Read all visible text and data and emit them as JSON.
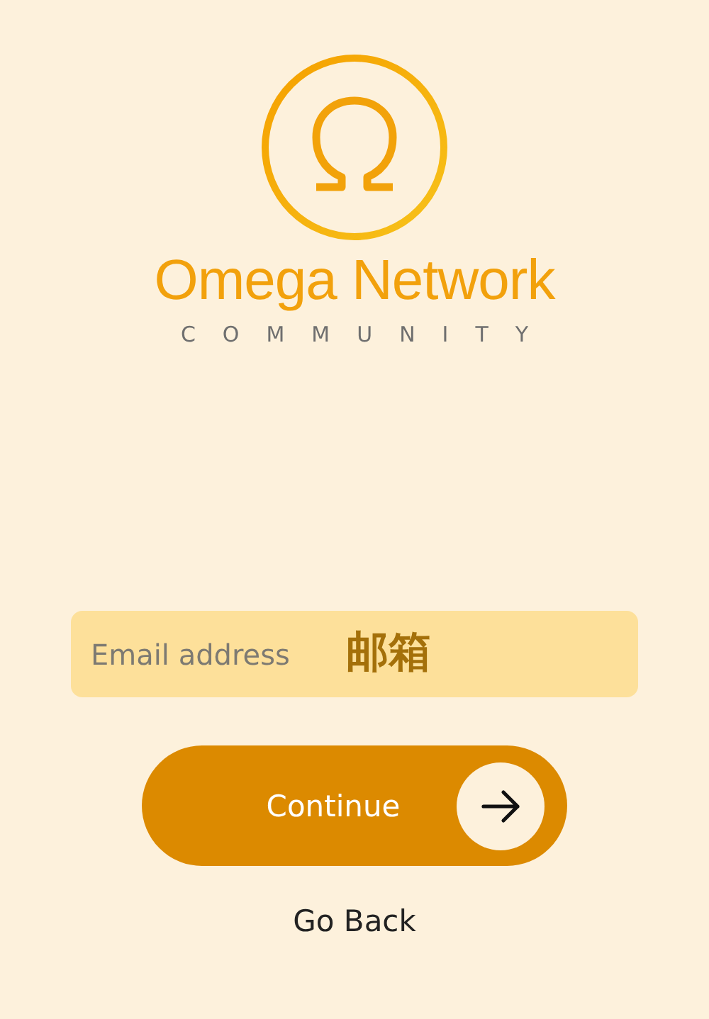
{
  "brand": {
    "name": "Omega Network",
    "tagline": "COMMUNITY"
  },
  "email_field": {
    "placeholder": "Email address",
    "annotation": "邮箱"
  },
  "continue_button": {
    "label": "Continue"
  },
  "back_link": {
    "label": "Go Back"
  }
}
